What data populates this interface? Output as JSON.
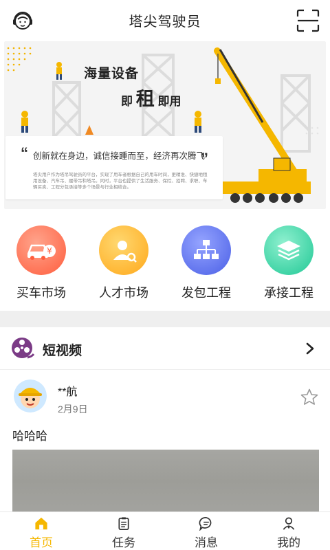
{
  "header": {
    "title": "塔尖驾驶员",
    "avatar_icon": "headset-avatar-icon",
    "scan_icon": "scan-icon"
  },
  "banner": {
    "tagline_line1": "海量设备",
    "tagline_prefix": "即",
    "tagline_big": "租",
    "tagline_suffix": "即用",
    "quote": "创新就在身边，诚信接踵而至，经济再次腾飞",
    "fine_print": "塔尖用户作为塔吊驾驶员的平台，实现了用车者根据自己的用车时间，更精准、快捷地租用设备、汽车吊、履带吊和塔吊。同时，平台也提供了生活服务、保险、招聘、求职、车辆买卖、工程分包承接等多个场景与行业相结合。"
  },
  "shortcuts": [
    {
      "label": "买车市场",
      "icon": "car-market-icon",
      "color": "#ff6a4d"
    },
    {
      "label": "人才市场",
      "icon": "talent-icon",
      "color": "#ffb31a"
    },
    {
      "label": "发包工程",
      "icon": "org-chart-icon",
      "color": "#5a6ff0"
    },
    {
      "label": "承接工程",
      "icon": "layers-icon",
      "color": "#2fd0a3"
    }
  ],
  "video_section": {
    "title": "短视频",
    "icon": "film-reel-icon"
  },
  "post": {
    "username": "**航",
    "date": "2月9日",
    "text": "哈哈哈"
  },
  "tabs": [
    {
      "label": "首页",
      "icon": "home-icon",
      "active": true
    },
    {
      "label": "任务",
      "icon": "clipboard-icon",
      "active": false
    },
    {
      "label": "消息",
      "icon": "message-icon",
      "active": false
    },
    {
      "label": "我的",
      "icon": "user-icon",
      "active": false
    }
  ],
  "colors": {
    "accent": "#f5b700",
    "crane": "#f7b500"
  }
}
